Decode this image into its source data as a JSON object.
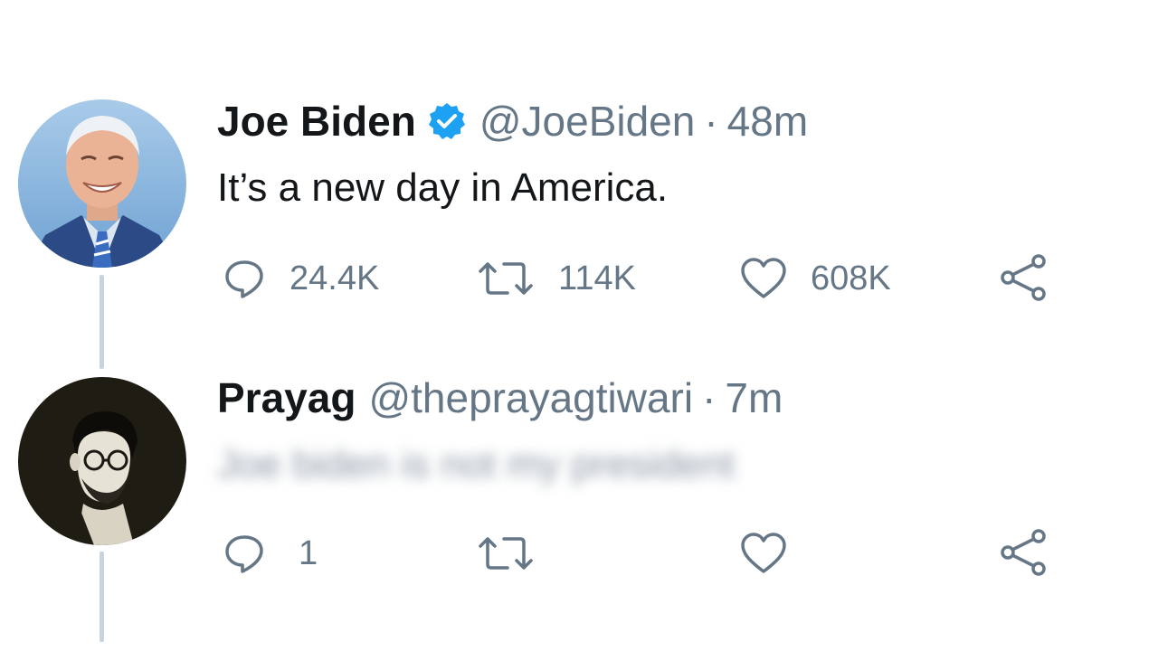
{
  "thread": [
    {
      "display_name": "Joe Biden",
      "verified": true,
      "handle": "@JoeBiden",
      "separator": "·",
      "time": "48m",
      "text": "It’s a new day in America.",
      "text_blurred": false,
      "avatar": "joe-biden-photo",
      "actions": {
        "reply": {
          "icon": "reply-icon",
          "count": "24.4K"
        },
        "retweet": {
          "icon": "retweet-icon",
          "count": "114K"
        },
        "like": {
          "icon": "heart-icon",
          "count": "608K"
        },
        "share": {
          "icon": "share-icon"
        }
      }
    },
    {
      "display_name": "Prayag",
      "verified": false,
      "handle": "@theprayagtiwari",
      "separator": "·",
      "time": "7m",
      "text": "Joe biden is not my president",
      "text_blurred": true,
      "avatar": "prayag-photo",
      "actions": {
        "reply": {
          "icon": "reply-icon",
          "count": "1"
        },
        "retweet": {
          "icon": "retweet-icon",
          "count": ""
        },
        "like": {
          "icon": "heart-icon",
          "count": ""
        },
        "share": {
          "icon": "share-icon"
        }
      }
    }
  ],
  "colors": {
    "verified_blue": "#1da1f2",
    "secondary_text": "#657786",
    "thread_line": "#c8d3dc"
  }
}
